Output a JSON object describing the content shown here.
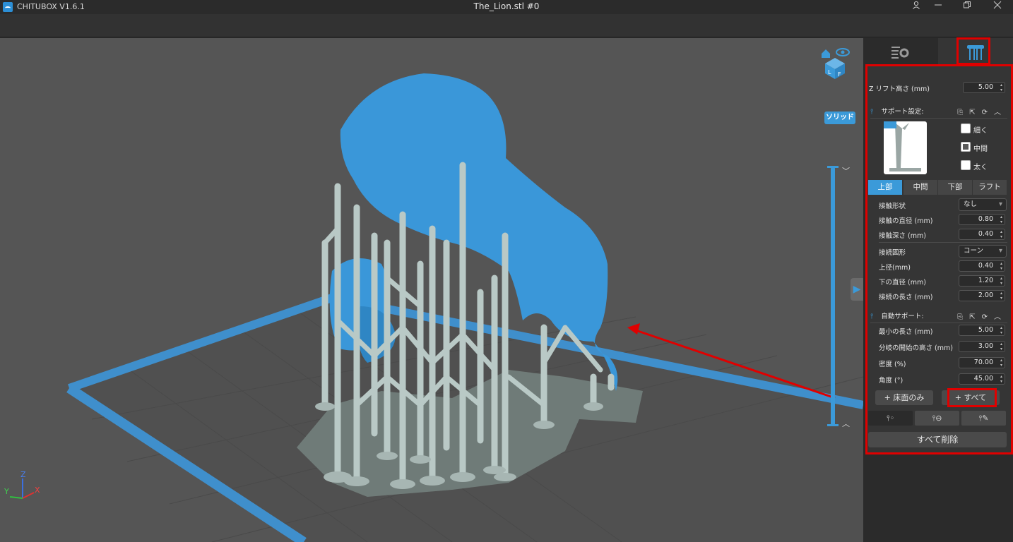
{
  "titlebar": {
    "app_name": "CHITUBOX V1.6.1",
    "document_title": "The_Lion.stl #0",
    "user_icon": "user-icon",
    "minimize_icon": "minimize-icon",
    "restore_icon": "restore-icon",
    "close_icon": "close-icon"
  },
  "viewport": {
    "render_mode_label": "ソリッド",
    "view_cube_icon": "view-cube-icon",
    "axes": {
      "x": "X",
      "y": "Y",
      "z": "Z"
    },
    "colors": {
      "model": "#3a97d9",
      "supports": "#b9c9c6",
      "plate_border": "#3f8fcc",
      "background": "#555555"
    }
  },
  "sidebar": {
    "tabs": [
      {
        "name": "print-settings",
        "icon": "settings-icon"
      },
      {
        "name": "support",
        "icon": "support-icon"
      }
    ],
    "z_lift": {
      "label": "Z リフト高さ (mm)",
      "value": "5.00"
    },
    "support_settings": {
      "title": "サポート設定:",
      "presets": [
        {
          "label": "細く",
          "checked": false
        },
        {
          "label": "中間",
          "checked": true
        },
        {
          "label": "太く",
          "checked": false
        }
      ],
      "subtabs": [
        "上部",
        "中間",
        "下部",
        "ラフト"
      ],
      "active_subtab": "上部",
      "contact_shape": {
        "label": "接触形状",
        "value": "なし"
      },
      "contact_diameter": {
        "label": "接触の直径 (mm)",
        "value": "0.80"
      },
      "contact_depth": {
        "label": "接触深さ (mm)",
        "value": "0.40"
      },
      "connection_shape": {
        "label": "接続図形",
        "value": "コーン"
      },
      "upper_diameter": {
        "label": "上径(mm)",
        "value": "0.40"
      },
      "lower_diameter": {
        "label": "下の直径 (mm)",
        "value": "1.20"
      },
      "connection_length": {
        "label": "接続の長さ (mm)",
        "value": "2.00"
      }
    },
    "auto_support": {
      "title": "自動サポート:",
      "min_length": {
        "label": "最小の長さ (mm)",
        "value": "5.00"
      },
      "branch_start_height": {
        "label": "分岐の開始の高さ (mm)",
        "value": "3.00"
      },
      "density": {
        "label": "密度 (%)",
        "value": "70.00"
      },
      "angle": {
        "label": "角度 (°)",
        "value": "45.00"
      }
    },
    "buttons": {
      "platform_only": "+ 床面のみ",
      "all": "+ すべて",
      "delete_all": "すべて削除"
    }
  }
}
